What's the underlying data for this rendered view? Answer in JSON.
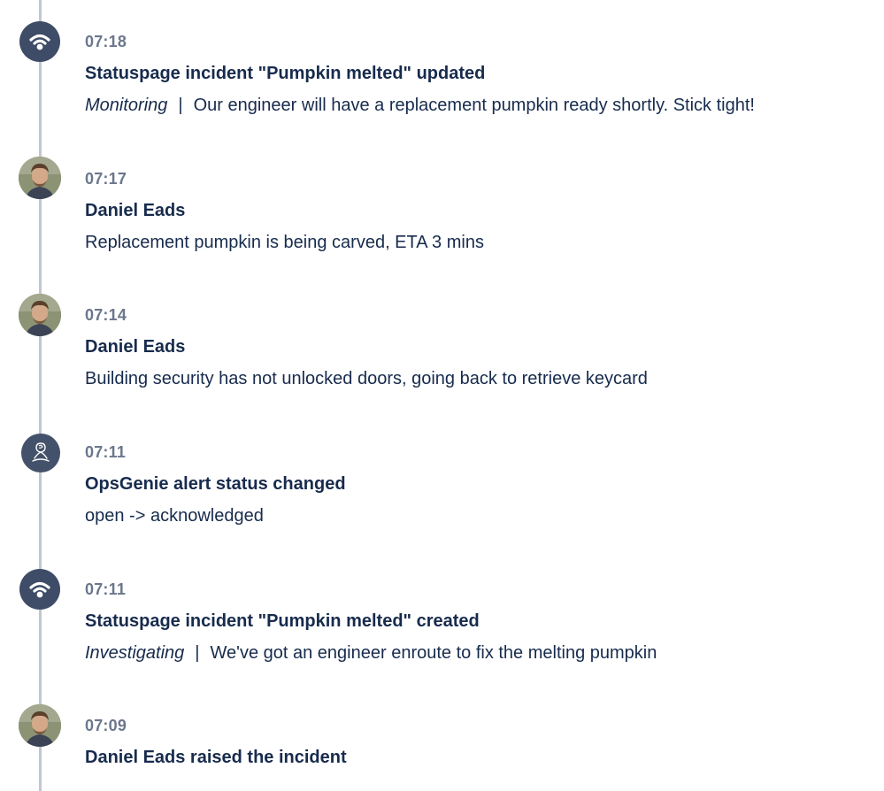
{
  "events": [
    {
      "kind": "statuspage",
      "icon": "broadcast-icon",
      "time": "07:18",
      "title": "Statuspage incident \"Pumpkin melted\" updated",
      "status": "Monitoring",
      "separator": "|",
      "message": "Our engineer will have a replacement pumpkin ready shortly. Stick tight!"
    },
    {
      "kind": "comment",
      "icon": "avatar",
      "time": "07:17",
      "title": "Daniel Eads",
      "message": "Replacement pumpkin is being carved, ETA 3 mins"
    },
    {
      "kind": "comment",
      "icon": "avatar",
      "time": "07:14",
      "title": "Daniel Eads",
      "message": "Building security has not unlocked doors, going back to retrieve keycard"
    },
    {
      "kind": "opsgenie",
      "icon": "opsgenie-icon",
      "time": "07:11",
      "title": "OpsGenie alert status changed",
      "message": "open -> acknowledged"
    },
    {
      "kind": "statuspage",
      "icon": "broadcast-icon",
      "time": "07:11",
      "title": "Statuspage incident \"Pumpkin melted\" created",
      "status": "Investigating",
      "separator": "|",
      "message": "We've got an engineer enroute to fix the melting pumpkin"
    },
    {
      "kind": "raised",
      "icon": "avatar",
      "time": "07:09",
      "title": "Daniel Eads raised the incident"
    }
  ]
}
